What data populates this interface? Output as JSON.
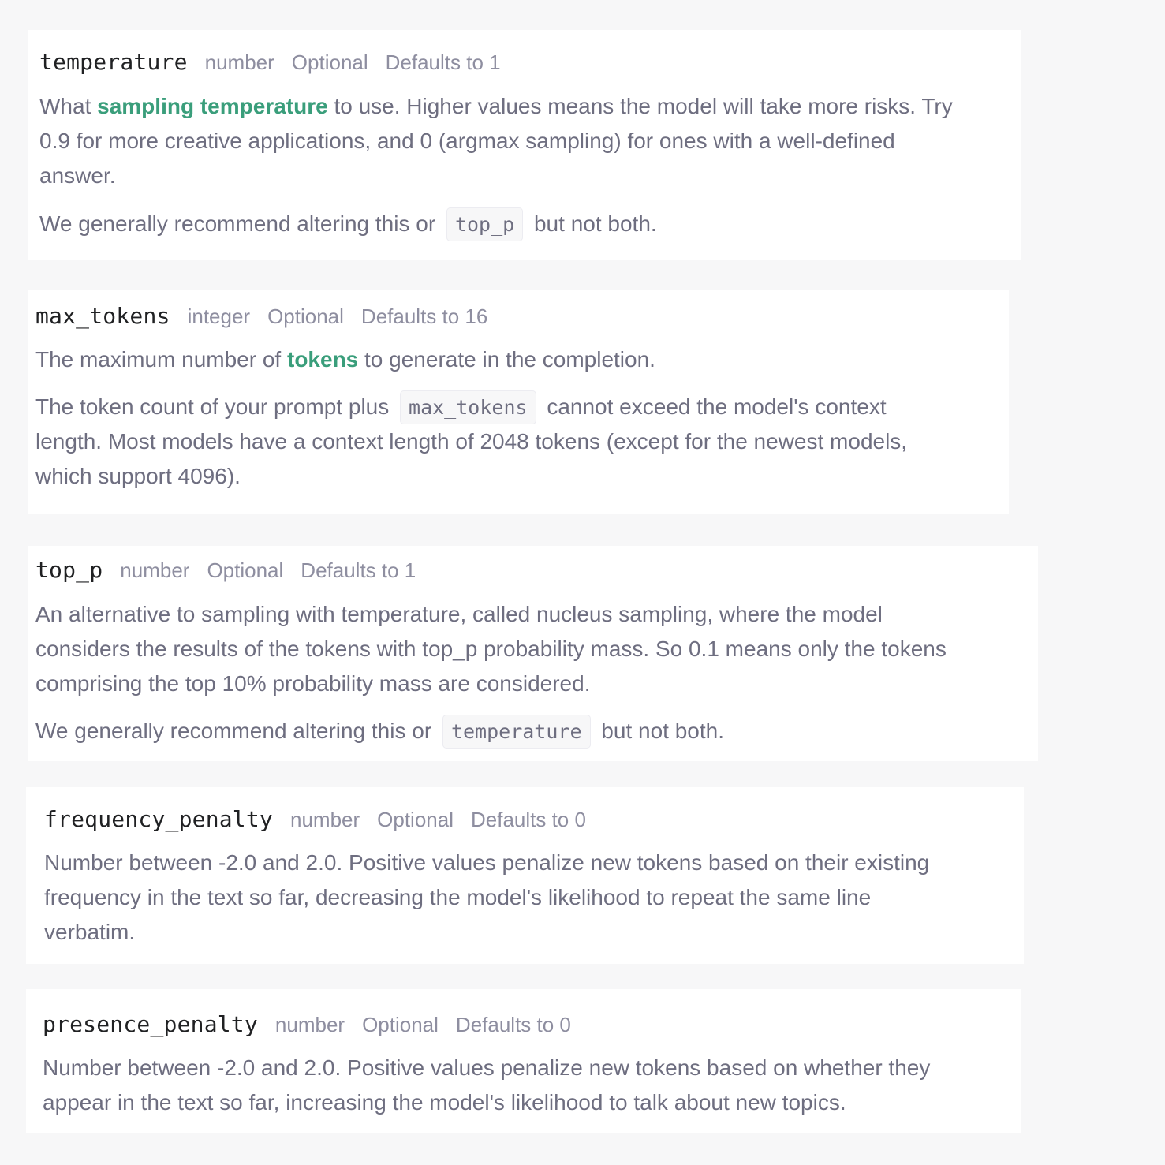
{
  "params": [
    {
      "name": "temperature",
      "type": "number",
      "optional": "Optional",
      "default": "Defaults to 1",
      "p1": {
        "before": "What ",
        "link": "sampling temperature",
        "line1_after": " to use. Higher values means the model will take more risks. Try",
        "line2": "0.9 for more creative applications, and 0 (argmax sampling) for ones with a well-defined",
        "line3": "answer."
      },
      "p2": {
        "before": "We generally recommend altering this or",
        "code": "top_p",
        "after": "but not both."
      }
    },
    {
      "name": "max_tokens",
      "type": "integer",
      "optional": "Optional",
      "default": "Defaults to 16",
      "p1": {
        "before": "The maximum number of ",
        "link": "tokens",
        "after": " to generate in the completion."
      },
      "p2": {
        "before": "The token count of your prompt plus",
        "code": "max_tokens",
        "line1_after": "cannot exceed the model's context",
        "line2": "length. Most models have a context length of 2048 tokens (except for the newest models,",
        "line3": "which support 4096)."
      }
    },
    {
      "name": "top_p",
      "type": "number",
      "optional": "Optional",
      "default": "Defaults to 1",
      "p1": {
        "line1": "An alternative to sampling with temperature, called nucleus sampling, where the model",
        "line2": "considers the results of the tokens with top_p probability mass. So 0.1 means only the tokens",
        "line3": "comprising the top 10% probability mass are considered."
      },
      "p2": {
        "before": "We generally recommend altering this or",
        "code": "temperature",
        "after": "but not both."
      }
    },
    {
      "name": "frequency_penalty",
      "type": "number",
      "optional": "Optional",
      "default": "Defaults to 0",
      "p1": {
        "line1": "Number between -2.0 and 2.0. Positive values penalize new tokens based on their existing",
        "line2": "frequency in the text so far, decreasing the model's likelihood to repeat the same line",
        "line3": "verbatim."
      }
    },
    {
      "name": "presence_penalty",
      "type": "number",
      "optional": "Optional",
      "default": "Defaults to 0",
      "p1": {
        "line1": "Number between -2.0 and 2.0. Positive values penalize new tokens based on whether they",
        "line2": "appear in the text so far, increasing the model's likelihood to talk about new topics."
      }
    }
  ]
}
